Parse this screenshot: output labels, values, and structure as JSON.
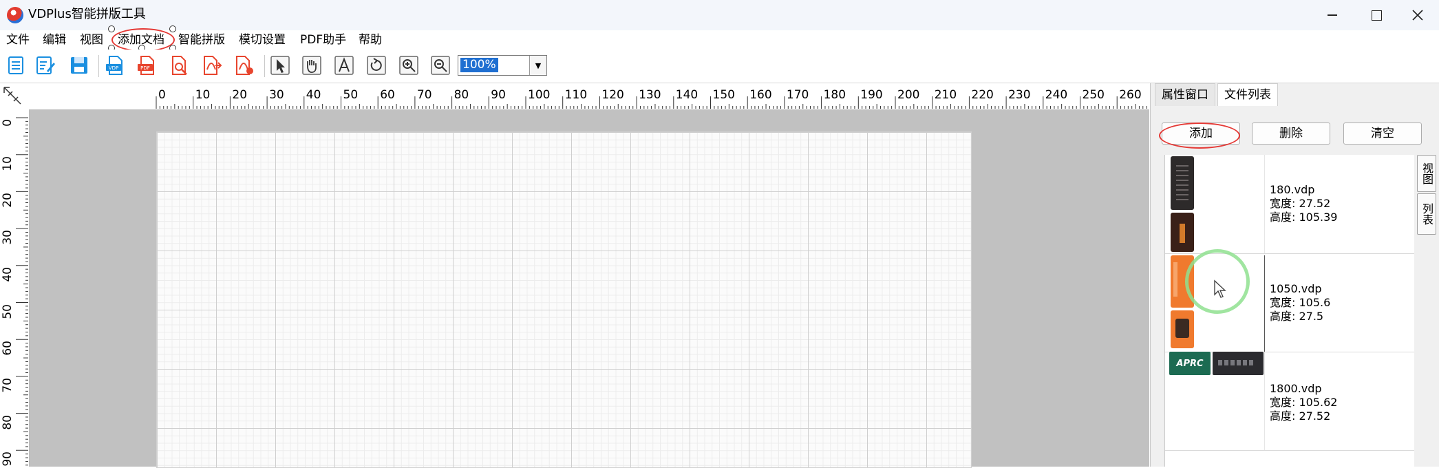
{
  "window": {
    "title": "VDPlus智能拼版工具"
  },
  "menu": [
    "文件",
    "编辑",
    "视图",
    "添加文档",
    "智能拼版",
    "模切设置",
    "PDF助手",
    "帮助"
  ],
  "toolbar": {
    "zoom": "100%",
    "icons": [
      "new-doc-icon",
      "edit-doc-icon",
      "save-icon",
      "import-vdp-icon",
      "import-pdf-icon",
      "pdf-search-icon",
      "pdf-export-icon",
      "pdf-convert-icon",
      "select-arrow-icon",
      "hand-pan-icon",
      "text-tool-icon",
      "rotate-icon",
      "zoom-in-icon",
      "zoom-out-icon"
    ]
  },
  "ruler": {
    "top": [
      "0",
      "10",
      "20",
      "30",
      "40",
      "50",
      "60",
      "70",
      "80",
      "90",
      "100",
      "110",
      "120",
      "130",
      "140",
      "150",
      "160",
      "170",
      "180",
      "190",
      "200",
      "210",
      "220",
      "230",
      "240",
      "250",
      "260"
    ],
    "left": [
      "0",
      "10",
      "20",
      "30",
      "40",
      "50",
      "60",
      "70",
      "80",
      "90"
    ]
  },
  "panel": {
    "tabs": [
      "属性窗口",
      "文件列表"
    ],
    "buttons": {
      "add": "添加",
      "delete": "删除",
      "clear": "清空"
    },
    "side_tabs": [
      "视图",
      "列表"
    ],
    "files": [
      {
        "name": "180.vdp",
        "width": "宽度: 27.52",
        "height": "高度: 105.39"
      },
      {
        "name": "1050.vdp",
        "width": "宽度: 105.6",
        "height": "高度: 27.5"
      },
      {
        "name": "1800.vdp",
        "width": "宽度: 105.62",
        "height": "高度: 27.52"
      }
    ],
    "thumb_text": {
      "aprc": "APRC"
    }
  },
  "colors": {
    "accent": "#1f6fd1",
    "highlight": "#e53935",
    "cursor_ring": "#8fe08f",
    "vdp_blue": "#1a8fe0",
    "pdf_red": "#e8452e"
  }
}
